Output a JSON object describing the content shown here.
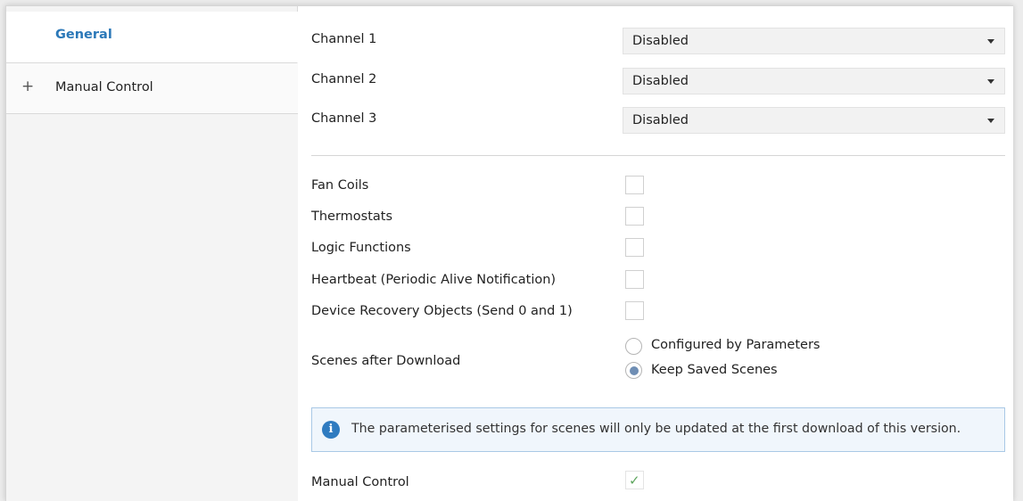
{
  "sidebar": {
    "items": [
      {
        "label": "General",
        "selected": true
      },
      {
        "label": "Manual Control",
        "expand_icon": "plus-icon"
      }
    ]
  },
  "channels": [
    {
      "label": "Channel 1",
      "value": "Disabled"
    },
    {
      "label": "Channel 2",
      "value": "Disabled"
    },
    {
      "label": "Channel 3",
      "value": "Disabled"
    }
  ],
  "options": [
    {
      "label": "Fan Coils",
      "checked": false
    },
    {
      "label": "Thermostats",
      "checked": false
    },
    {
      "label": "Logic Functions",
      "checked": false
    },
    {
      "label": "Heartbeat (Periodic Alive Notification)",
      "checked": false
    },
    {
      "label": "Device Recovery Objects (Send 0 and 1)",
      "checked": false
    }
  ],
  "scenes": {
    "label": "Scenes after Download",
    "choices": [
      {
        "label": "Configured by Parameters",
        "selected": false
      },
      {
        "label": "Keep Saved Scenes",
        "selected": true
      }
    ]
  },
  "info": {
    "icon": "info-icon",
    "glyph": "i",
    "text": "The parameterised settings for scenes will only be updated at the first download of this version."
  },
  "manual_control": {
    "label": "Manual Control",
    "checked": true,
    "check_glyph": "✓"
  },
  "colors": {
    "accent": "#2b78b8",
    "info_bg": "#f0f6fc",
    "info_border": "#a9c9e6",
    "check": "#5fa65f",
    "radio_dot": "#6f8eb4"
  }
}
